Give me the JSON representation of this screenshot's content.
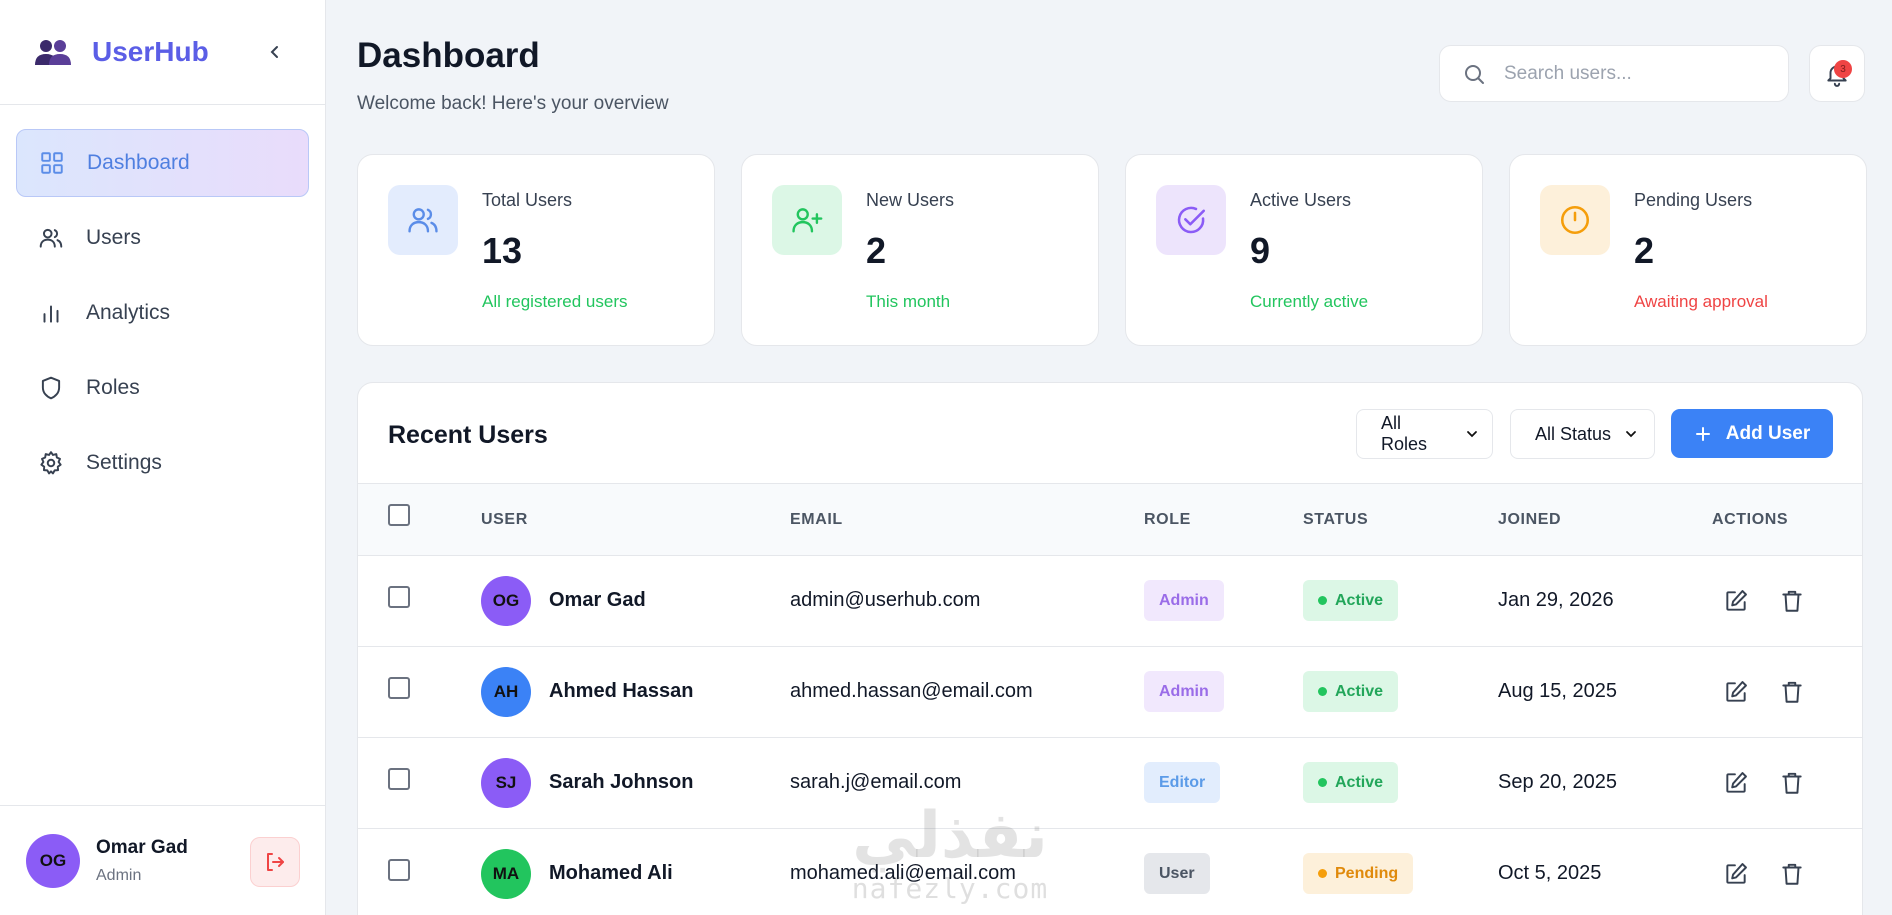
{
  "brand": {
    "name": "UserHub",
    "icon": "users-logo-icon"
  },
  "sidebar": {
    "items": [
      {
        "label": "Dashboard",
        "icon": "grid-icon",
        "active": true
      },
      {
        "label": "Users",
        "icon": "users-icon",
        "active": false
      },
      {
        "label": "Analytics",
        "icon": "bar-chart-icon",
        "active": false
      },
      {
        "label": "Roles",
        "icon": "shield-icon",
        "active": false
      },
      {
        "label": "Settings",
        "icon": "gear-icon",
        "active": false
      }
    ],
    "user": {
      "initials": "OG",
      "name": "Omar Gad",
      "role": "Admin"
    }
  },
  "header": {
    "title": "Dashboard",
    "subtitle": "Welcome back! Here's your overview",
    "search_placeholder": "Search users...",
    "notifications": "3"
  },
  "stats": [
    {
      "label": "Total Users",
      "value": "13",
      "note": "All registered users",
      "note_color": "#22c55e",
      "icon": "users-icon",
      "icon_bg": "#e3ecfd",
      "icon_color": "#5b8de8"
    },
    {
      "label": "New Users",
      "value": "2",
      "note": "This month",
      "note_color": "#22c55e",
      "icon": "user-plus-icon",
      "icon_bg": "#dcf7e6",
      "icon_color": "#22c55e"
    },
    {
      "label": "Active Users",
      "value": "9",
      "note": "Currently active",
      "note_color": "#22c55e",
      "icon": "check-circle-icon",
      "icon_bg": "#ede4fc",
      "icon_color": "#8b5cf6"
    },
    {
      "label": "Pending Users",
      "value": "2",
      "note": "Awaiting approval",
      "note_color": "#ef4444",
      "icon": "clock-icon",
      "icon_bg": "#fdf0da",
      "icon_color": "#f59e0b"
    }
  ],
  "recent": {
    "title": "Recent Users",
    "role_filter": "All Roles",
    "status_filter": "All Status",
    "add_label": "Add User",
    "columns": {
      "user": "USER",
      "email": "EMAIL",
      "role": "ROLE",
      "status": "STATUS",
      "joined": "JOINED",
      "actions": "ACTIONS"
    },
    "rows": [
      {
        "initials": "OG",
        "avatar_color": "#8b5cf6",
        "name": "Omar Gad",
        "email": "admin@userhub.com",
        "role": "Admin",
        "role_bg": "#f1e8fd",
        "role_color": "#9a6ce8",
        "status": "Active",
        "status_bg": "#dcf7e6",
        "status_color": "#22a65a",
        "dot_color": "#22c55e",
        "joined": "Jan 29, 2026"
      },
      {
        "initials": "AH",
        "avatar_color": "#3b82f6",
        "name": "Ahmed Hassan",
        "email": "ahmed.hassan@email.com",
        "role": "Admin",
        "role_bg": "#f1e8fd",
        "role_color": "#9a6ce8",
        "status": "Active",
        "status_bg": "#dcf7e6",
        "status_color": "#22a65a",
        "dot_color": "#22c55e",
        "joined": "Aug 15, 2025"
      },
      {
        "initials": "SJ",
        "avatar_color": "#8b5cf6",
        "name": "Sarah Johnson",
        "email": "sarah.j@email.com",
        "role": "Editor",
        "role_bg": "#e2edfd",
        "role_color": "#5b9be8",
        "status": "Active",
        "status_bg": "#dcf7e6",
        "status_color": "#22a65a",
        "dot_color": "#22c55e",
        "joined": "Sep 20, 2025"
      },
      {
        "initials": "MA",
        "avatar_color": "#22c55e",
        "name": "Mohamed Ali",
        "email": "mohamed.ali@email.com",
        "role": "User",
        "role_bg": "#e5e7eb",
        "role_color": "#4b5563",
        "status": "Pending",
        "status_bg": "#fdf0da",
        "status_color": "#e08a0b",
        "dot_color": "#f59e0b",
        "joined": "Oct 5, 2025"
      }
    ]
  },
  "watermark": {
    "arabic": "نفذلي",
    "latin": "nafezly.com"
  }
}
